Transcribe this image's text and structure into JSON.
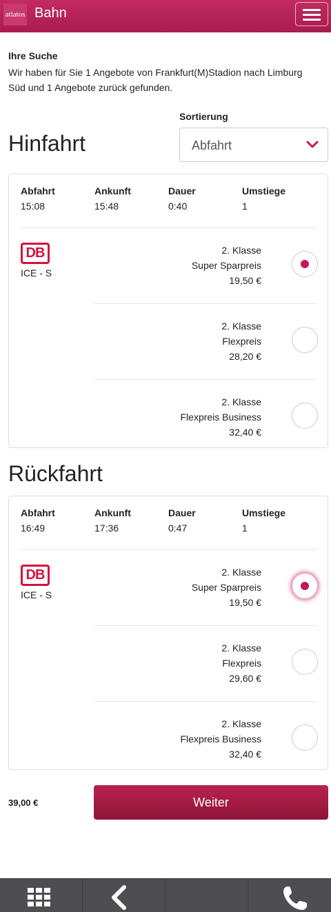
{
  "header": {
    "logo_text": "atlatos",
    "title": "Bahn",
    "menu_icon": "hamburger-icon"
  },
  "search": {
    "heading": "Ihre Suche",
    "text": "Wir haben für Sie 1 Angebote von Frankfurt(M)Stadion nach Limburg Süd und 1 Angebote zurück gefunden."
  },
  "sort": {
    "label": "Sortierung",
    "value": "Abfahrt",
    "chevron_icon": "chevron-down-icon"
  },
  "columns": {
    "departure": "Abfahrt",
    "arrival": "Ankunft",
    "duration": "Dauer",
    "changes": "Umstiege"
  },
  "outbound": {
    "title": "Hinfahrt",
    "departure": "15:08",
    "arrival": "15:48",
    "duration": "0:40",
    "changes": "1",
    "operator_logo": "DB",
    "train": "ICE - S",
    "offers": [
      {
        "class": "2. Klasse",
        "fare": "Super Sparpreis",
        "price": "19,50 €",
        "selected": true
      },
      {
        "class": "2. Klasse",
        "fare": "Flexpreis",
        "price": "28,20 €",
        "selected": false
      },
      {
        "class": "2. Klasse",
        "fare": "Flexpreis Business",
        "price": "32,40 €",
        "selected": false
      }
    ]
  },
  "return": {
    "title": "Rückfahrt",
    "departure": "16:49",
    "arrival": "17:36",
    "duration": "0:47",
    "changes": "1",
    "operator_logo": "DB",
    "train": "ICE - S",
    "offers": [
      {
        "class": "2. Klasse",
        "fare": "Super Sparpreis",
        "price": "19,50 €",
        "selected": true
      },
      {
        "class": "2. Klasse",
        "fare": "Flexpreis",
        "price": "29,60 €",
        "selected": false
      },
      {
        "class": "2. Klasse",
        "fare": "Flexpreis Business",
        "price": "32,40 €",
        "selected": false
      }
    ]
  },
  "footer": {
    "total": "39,00 €",
    "next_label": "Weiter"
  },
  "bottom_nav": {
    "items": [
      "grid-icon",
      "back-icon",
      "blank",
      "phone-icon"
    ]
  },
  "colors": {
    "brand": "#b01f52",
    "db_red": "#d4113a",
    "nav_bg": "#4e4e52"
  }
}
